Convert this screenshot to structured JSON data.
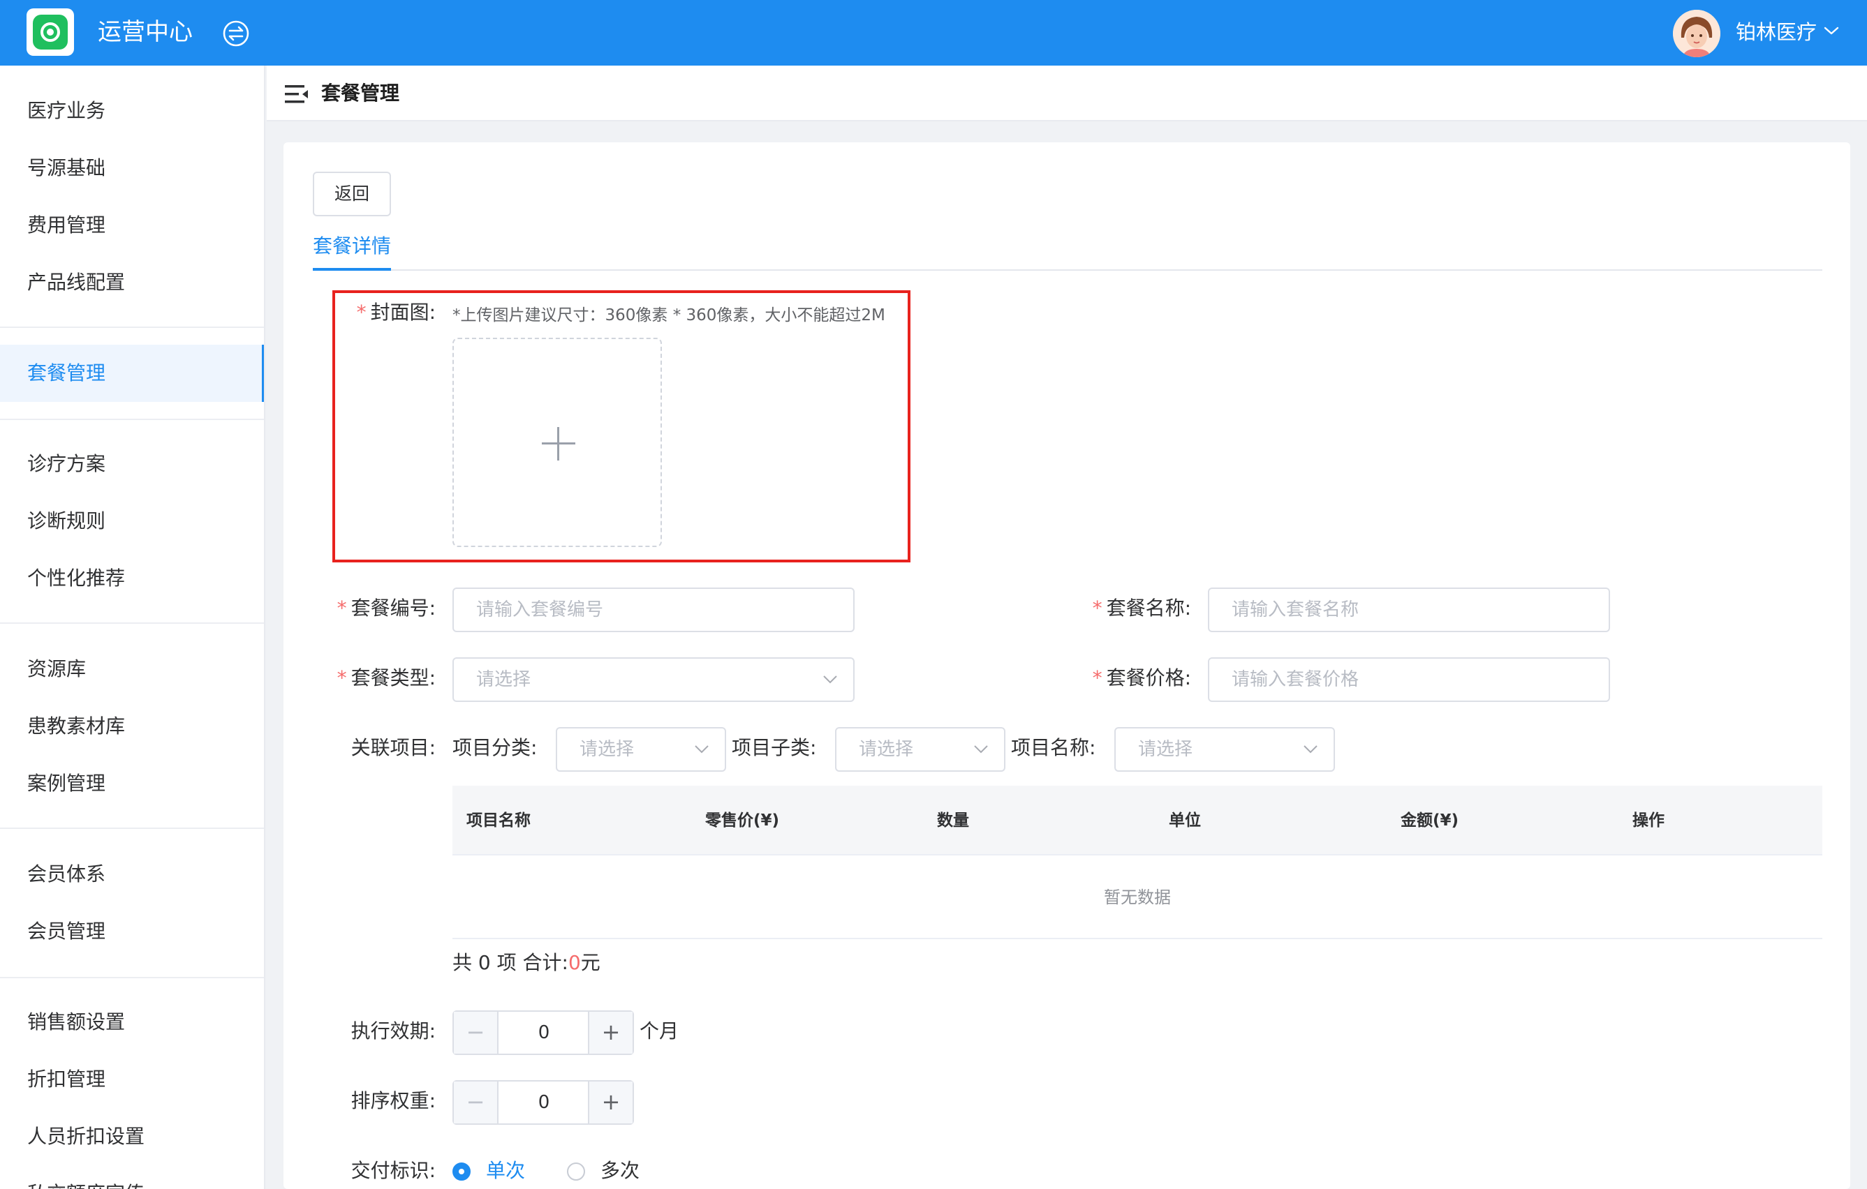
{
  "header": {
    "app_title": "运营中心",
    "user_name": "铂林医疗",
    "switch_icon": "switch-arrows-icon",
    "colors": {
      "primary": "#1e8cf0",
      "logo_green": "#1fbf5e"
    }
  },
  "sidebar": {
    "items": [
      {
        "label": "医疗业务",
        "active": false
      },
      {
        "label": "号源基础",
        "active": false
      },
      {
        "label": "费用管理",
        "active": false
      },
      {
        "label": "产品线配置",
        "active": false
      },
      {
        "label": "套餐管理",
        "active": true
      },
      {
        "label": "诊疗方案",
        "active": false
      },
      {
        "label": "诊断规则",
        "active": false
      },
      {
        "label": "个性化推荐",
        "active": false
      },
      {
        "label": "资源库",
        "active": false
      },
      {
        "label": "患教素材库",
        "active": false
      },
      {
        "label": "案例管理",
        "active": false
      },
      {
        "label": "会员体系",
        "active": false
      },
      {
        "label": "会员管理",
        "active": false
      },
      {
        "label": "销售额设置",
        "active": false
      },
      {
        "label": "折扣管理",
        "active": false
      },
      {
        "label": "人员折扣设置",
        "active": false
      },
      {
        "label": "私交额度宣传",
        "active": false
      }
    ]
  },
  "page": {
    "title": "套餐管理",
    "back_label": "返回",
    "tab_label": "套餐详情"
  },
  "form": {
    "cover": {
      "label": "封面图:",
      "hint": "*上传图片建议尺寸：360像素 * 360像素，大小不能超过2M"
    },
    "package_code": {
      "label": "套餐编号:",
      "placeholder": "请输入套餐编号"
    },
    "package_name": {
      "label": "套餐名称:",
      "placeholder": "请输入套餐名称"
    },
    "package_type": {
      "label": "套餐类型:",
      "placeholder": "请选择"
    },
    "package_price": {
      "label": "套餐价格:",
      "placeholder": "请输入套餐价格"
    },
    "related": {
      "label": "关联项目:",
      "category_label": "项目分类:",
      "category_placeholder": "请选择",
      "subcategory_label": "项目子类:",
      "subcategory_placeholder": "请选择",
      "name_label": "项目名称:",
      "name_placeholder": "请选择"
    },
    "table": {
      "columns": [
        "项目名称",
        "零售价(¥)",
        "数量",
        "单位",
        "金额(¥)",
        "操作"
      ],
      "empty_text": "暂无数据",
      "summary_prefix": "共 0 项 合计:",
      "summary_total": "0",
      "summary_suffix": "元"
    },
    "validity": {
      "label": "执行效期:",
      "value": "0",
      "unit": "个月"
    },
    "sort_weight": {
      "label": "排序权重:",
      "value": "0"
    },
    "delivery": {
      "label": "交付标识:",
      "options": [
        {
          "label": "单次",
          "checked": true
        },
        {
          "label": "多次",
          "checked": false
        }
      ]
    }
  }
}
